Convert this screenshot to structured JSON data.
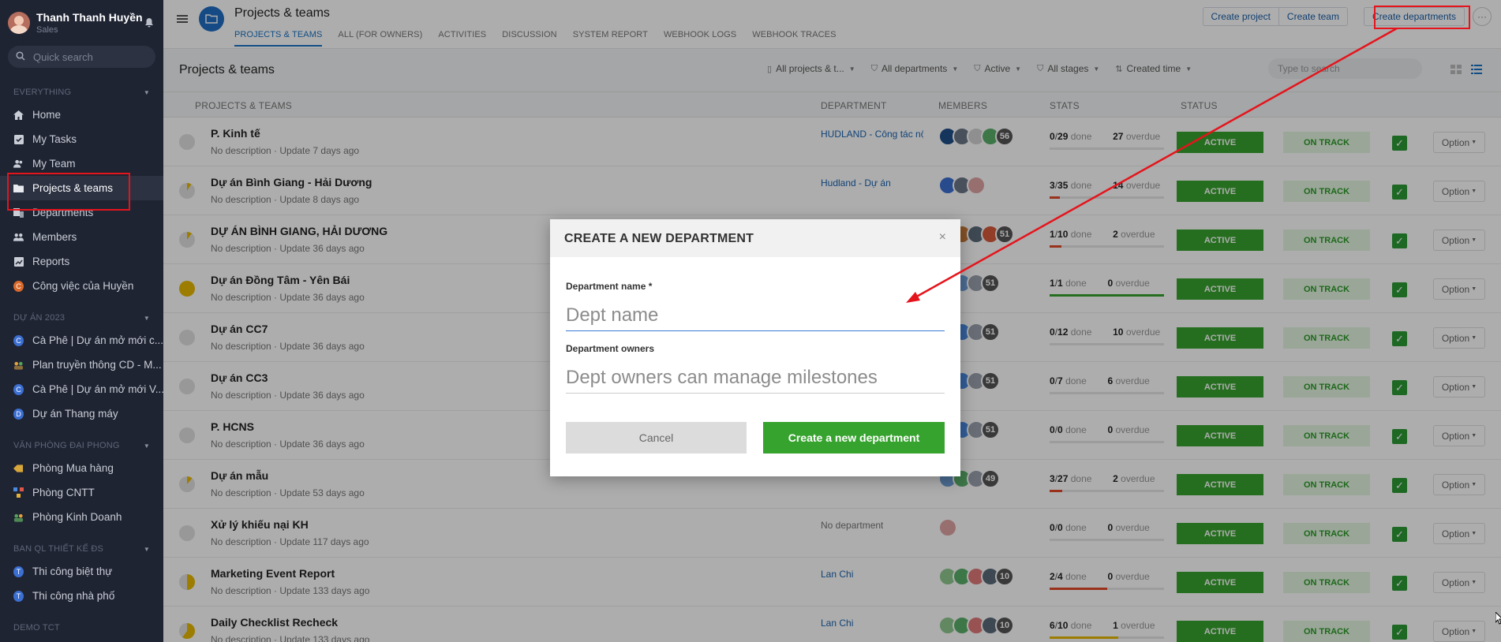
{
  "sidebar": {
    "user_name": "Thanh Thanh Huyền",
    "user_role": "Sales",
    "search_placeholder": "Quick search",
    "sections": [
      {
        "title": "EVERYTHING"
      },
      {
        "title": "DỰ ÁN 2023"
      },
      {
        "title": "VĂN PHÒNG ĐẠI PHONG"
      },
      {
        "title": "BAN QL THIẾT KẾ ĐS"
      },
      {
        "title": "DEMO TCT"
      }
    ],
    "main_items": [
      {
        "label": "Home",
        "icon": "home-icon"
      },
      {
        "label": "My Tasks",
        "icon": "check-square-icon"
      },
      {
        "label": "My Team",
        "icon": "team-icon"
      },
      {
        "label": "Projects & teams",
        "icon": "folder-icon"
      },
      {
        "label": "Departments",
        "icon": "departments-icon"
      },
      {
        "label": "Members",
        "icon": "members-icon"
      },
      {
        "label": "Reports",
        "icon": "reports-icon"
      },
      {
        "label": "Công việc của Huyền",
        "icon": "letter-badge-c"
      }
    ],
    "project_items": [
      {
        "label": "Cà Phê | Dự án mở mới c...",
        "badge": "C",
        "color": "#3b6fd1"
      },
      {
        "label": "Plan truyền thông CD - M...",
        "badge": "",
        "color": "#8a6d3b"
      },
      {
        "label": "Cà Phê | Dự án mở mới V...",
        "badge": "C",
        "color": "#3b6fd1"
      },
      {
        "label": "Dự án Thang máy",
        "badge": "D",
        "color": "#3b6fd1"
      }
    ],
    "office_items": [
      {
        "label": "Phòng Mua hàng"
      },
      {
        "label": "Phòng CNTT"
      },
      {
        "label": "Phòng Kinh Doanh"
      }
    ],
    "design_items": [
      {
        "label": "Thi công biệt thự",
        "badge": "T"
      },
      {
        "label": "Thi công nhà phố",
        "badge": "T"
      }
    ]
  },
  "header": {
    "title": "Projects & teams",
    "tabs": [
      "PROJECTS & TEAMS",
      "ALL (FOR OWNERS)",
      "ACTIVITIES",
      "DISCUSSION",
      "SYSTEM REPORT",
      "WEBHOOK LOGS",
      "WEBHOOK TRACES"
    ],
    "create_project": "Create project",
    "create_team": "Create team",
    "create_departments": "Create departments",
    "more": "···"
  },
  "subbar": {
    "title": "Projects & teams",
    "filters": [
      "All projects & t...",
      "All departments",
      "Active",
      "All stages",
      "Created time"
    ],
    "search_placeholder": "Type to search"
  },
  "table": {
    "headers": [
      "PROJECTS & TEAMS",
      "DEPARTMENT",
      "MEMBERS",
      "STATS",
      "STATUS"
    ],
    "done_label": "done",
    "overdue_label": "overdue",
    "active_label": "ACTIVE",
    "on_track_label": "ON TRACK",
    "option_label": "Option",
    "rows": [
      {
        "name": "P. Kinh tế",
        "desc": "No description · Update 7 days ago",
        "dept": "HUDLAND - Công tác nội",
        "members": "56",
        "done": "0",
        "total": "29",
        "overdue": "27",
        "progress": 0,
        "bar_color": "#e6e6e6"
      },
      {
        "name": "Dự án Bình Giang - Hải Dương",
        "desc": "No description · Update 8 days ago",
        "dept": "Hudland - Dự án",
        "members": "",
        "done": "3",
        "total": "35",
        "overdue": "14",
        "progress": 0.09,
        "bar_color": "#e04b2a"
      },
      {
        "name": "DỰ ÁN BÌNH GIANG, HẢI DƯƠNG",
        "desc": "No description · Update 36 days ago",
        "dept": "",
        "members": "51",
        "done": "1",
        "total": "10",
        "overdue": "2",
        "progress": 0.1,
        "bar_color": "#e04b2a"
      },
      {
        "name": "Dự án Đồng Tâm - Yên Bái",
        "desc": "No description · Update 36 days ago",
        "dept": "",
        "members": "51",
        "done": "1",
        "total": "1",
        "overdue": "0",
        "progress": 1,
        "bar_color": "#37a32f"
      },
      {
        "name": "Dự án CC7",
        "desc": "No description · Update 36 days ago",
        "dept": "",
        "members": "51",
        "done": "0",
        "total": "12",
        "overdue": "10",
        "progress": 0,
        "bar_color": "#e6e6e6"
      },
      {
        "name": "Dự án CC3",
        "desc": "No description · Update 36 days ago",
        "dept": "",
        "members": "51",
        "done": "0",
        "total": "7",
        "overdue": "6",
        "progress": 0,
        "bar_color": "#e6e6e6"
      },
      {
        "name": "P. HCNS",
        "desc": "No description · Update 36 days ago",
        "dept": "",
        "members": "51",
        "done": "0",
        "total": "0",
        "overdue": "0",
        "progress": 0,
        "bar_color": "#e6e6e6"
      },
      {
        "name": "Dự án mẫu",
        "desc": "No description · Update 53 days ago",
        "dept": "",
        "members": "49",
        "done": "3",
        "total": "27",
        "overdue": "2",
        "progress": 0.11,
        "bar_color": "#e04b2a"
      },
      {
        "name": "Xử lý khiếu nại KH",
        "desc": "No description · Update 117 days ago",
        "dept": "No department",
        "members": "",
        "done": "0",
        "total": "0",
        "overdue": "0",
        "progress": 0,
        "bar_color": "#e6e6e6"
      },
      {
        "name": "Marketing Event Report",
        "desc": "No description · Update 133 days ago",
        "dept": "Lan Chi",
        "members": "10",
        "done": "2",
        "total": "4",
        "overdue": "0",
        "progress": 0.5,
        "bar_color": "#e04b2a"
      },
      {
        "name": "Daily Checklist Recheck",
        "desc": "No description · Update 133 days ago",
        "dept": "Lan Chi",
        "members": "10",
        "done": "6",
        "total": "10",
        "overdue": "1",
        "progress": 0.6,
        "bar_color": "#e6b800"
      }
    ]
  },
  "modal": {
    "title": "CREATE A NEW DEPARTMENT",
    "close": "×",
    "name_label": "Department name *",
    "name_placeholder": "Dept name",
    "owners_label": "Department owners",
    "owners_placeholder": "Dept owners can manage milestones",
    "cancel": "Cancel",
    "submit": "Create a new department"
  },
  "colors": {
    "sidebar_bg": "#1f2433",
    "accent": "#1a73c5",
    "active_green": "#37a32f",
    "highlight_red": "#e5141c"
  }
}
